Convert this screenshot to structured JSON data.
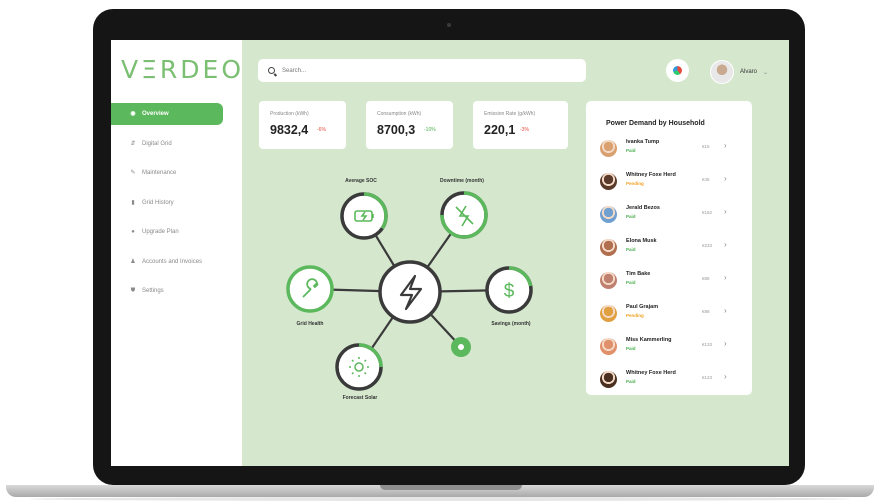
{
  "app": {
    "logo": "VΞRDEO"
  },
  "search": {
    "placeholder": "Search..."
  },
  "user": {
    "name": "Alvaro"
  },
  "sidebar": {
    "items": [
      {
        "label": "Overview",
        "icon": "eye-icon",
        "active": true
      },
      {
        "label": "Digital Grid",
        "icon": "grid-icon"
      },
      {
        "label": "Maintenance",
        "icon": "wrench-icon"
      },
      {
        "label": "Grid History",
        "icon": "chart-icon"
      },
      {
        "label": "Upgrade Plan",
        "icon": "upgrade-icon"
      },
      {
        "label": "Accounts and Invoices",
        "icon": "person-icon"
      },
      {
        "label": "Settings",
        "icon": "shield-icon"
      }
    ]
  },
  "stats": [
    {
      "label": "Production (kWh)",
      "value": "9832,4",
      "delta": "-6%",
      "trend": "neg"
    },
    {
      "label": "Consumption (kWh)",
      "value": "8700,3",
      "delta": "-10%",
      "trend": "pos"
    },
    {
      "label": "Emission Rate (g/kWh)",
      "value": "220,1",
      "delta": "-3%",
      "trend": "neg"
    }
  ],
  "hub": {
    "nodes": [
      {
        "label": "Average SOC",
        "icon": "battery-charging-icon",
        "progress": 0.6
      },
      {
        "label": "Downtime (month)",
        "icon": "power-off-icon",
        "progress": 0.75
      },
      {
        "label": "Savings (month)",
        "icon": "dollar-icon",
        "progress": 0.6
      },
      {
        "label": "Forecast Solar",
        "icon": "sun-icon",
        "progress": 0.5
      },
      {
        "label": "Grid Health",
        "icon": "wrench-icon",
        "progress": 1.0
      }
    ],
    "center_icon": "lightning-icon",
    "add_icon": "plus-icon"
  },
  "households": {
    "title": "Power Demand by Household",
    "rows": [
      {
        "name": "Ivanka Tump",
        "status": "Paid",
        "amount": "€15",
        "avatar_color": "#d9a070"
      },
      {
        "name": "Whitney Foxe Herd",
        "status": "Pending",
        "amount": "€45",
        "avatar_color": "#5a3a2a"
      },
      {
        "name": "Jerald Bezos",
        "status": "Paid",
        "amount": "€162",
        "avatar_color": "#6fa0d0"
      },
      {
        "name": "Elona Musk",
        "status": "Paid",
        "amount": "€233",
        "avatar_color": "#b07050"
      },
      {
        "name": "Tim Bake",
        "status": "Paid",
        "amount": "€88",
        "avatar_color": "#c08070"
      },
      {
        "name": "Paul Grajam",
        "status": "Pending",
        "amount": "€88",
        "avatar_color": "#e0a040"
      },
      {
        "name": "Miss Kammerling",
        "status": "Paid",
        "amount": "€133",
        "avatar_color": "#e0906a"
      },
      {
        "name": "Whitney Foxe Herd",
        "status": "Paid",
        "amount": "€123",
        "avatar_color": "#4a3020"
      }
    ]
  },
  "colors": {
    "accent": "#5cb85c",
    "screen_bg": "#d5e8ce",
    "pending": "#f0a020",
    "negative": "#e74c3c"
  }
}
